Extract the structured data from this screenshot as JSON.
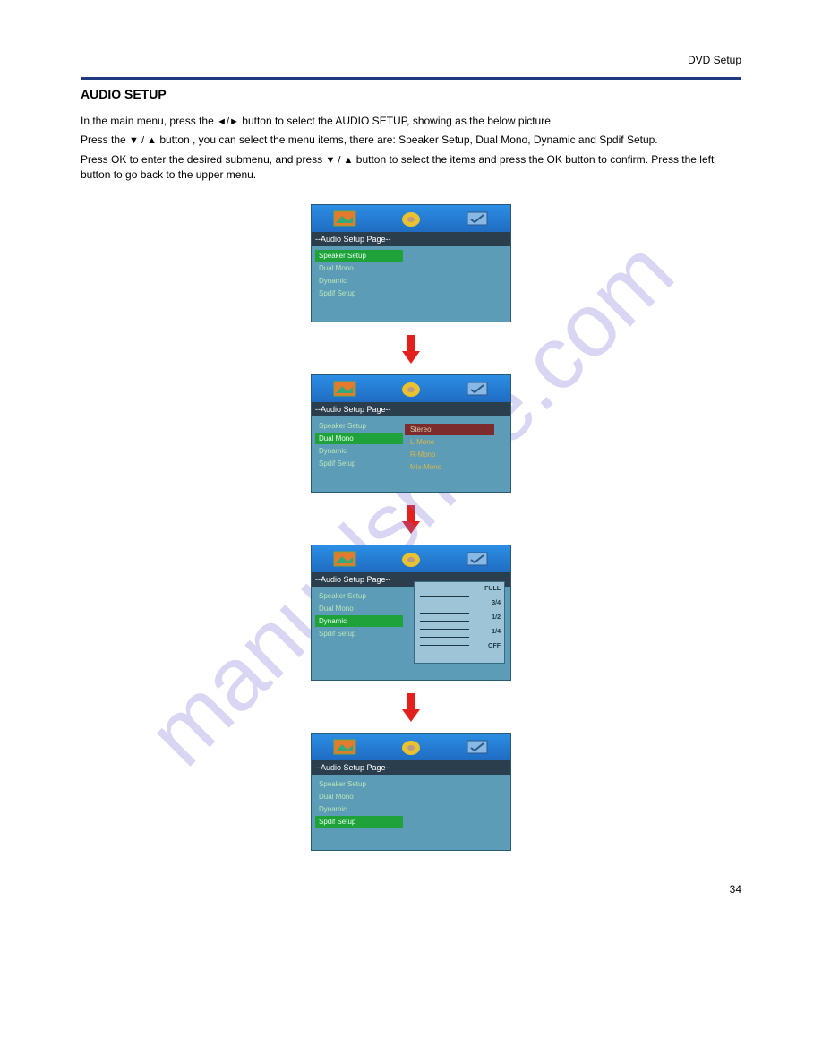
{
  "watermark": "manualshive.com",
  "header": "DVD Setup",
  "heading": "AUDIO SETUP",
  "text": {
    "p1_a": "In the main menu, press the ",
    "lr_glyph": "◄/►",
    "p1_b": " button to select the AUDIO SETUP, showing as the below picture.",
    "p2_a": "Press the ",
    "ud_glyph": "▼ / ▲",
    "p2_b": " button , you can select the menu items, there are: Speaker Setup, Dual Mono, Dynamic and Spdif Setup.",
    "p3_a": "Press OK to enter the desired submenu, and press ",
    "p3_b": " button to select the items and press the OK button to confirm. Press the left button to go back to the upper menu."
  },
  "osd_title": "--Audio Setup Page--",
  "panels": [
    {
      "items": [
        {
          "label": "Speaker  Setup",
          "sel": true
        },
        {
          "label": "Dual  Mono",
          "sel": false
        },
        {
          "label": "Dynamic",
          "sel": false
        },
        {
          "label": "Spdif  Setup",
          "sel": false
        }
      ],
      "variant": "short"
    },
    {
      "items": [
        {
          "label": "Speaker  Setup",
          "sel": false
        },
        {
          "label": "Dual  Mono",
          "sel": true
        },
        {
          "label": "Dynamic",
          "sel": false
        },
        {
          "label": "Spdif  Setup",
          "sel": false
        }
      ],
      "sub": [
        {
          "label": "Stereo",
          "redsel": true
        },
        {
          "label": "L-Mono",
          "gold": true
        },
        {
          "label": "R-Mono",
          "gold": true
        },
        {
          "label": "Mix-Mono",
          "gold": true
        }
      ],
      "variant": "short"
    },
    {
      "items": [
        {
          "label": "Speaker  Setup",
          "sel": false
        },
        {
          "label": "Dual  Mono",
          "sel": false
        },
        {
          "label": "Dynamic",
          "sel": true
        },
        {
          "label": "Spdif  Setup",
          "sel": false
        }
      ],
      "dyn_scale": [
        "FULL",
        "3/4",
        "1/2",
        "1/4",
        "OFF"
      ],
      "variant": "tall"
    },
    {
      "items": [
        {
          "label": "Speaker  Setup",
          "sel": false
        },
        {
          "label": "Dual  Mono",
          "sel": false
        },
        {
          "label": "Dynamic",
          "sel": false
        },
        {
          "label": "Spdif  Setup",
          "sel": true
        }
      ],
      "variant": "short"
    }
  ],
  "page_num": "34"
}
